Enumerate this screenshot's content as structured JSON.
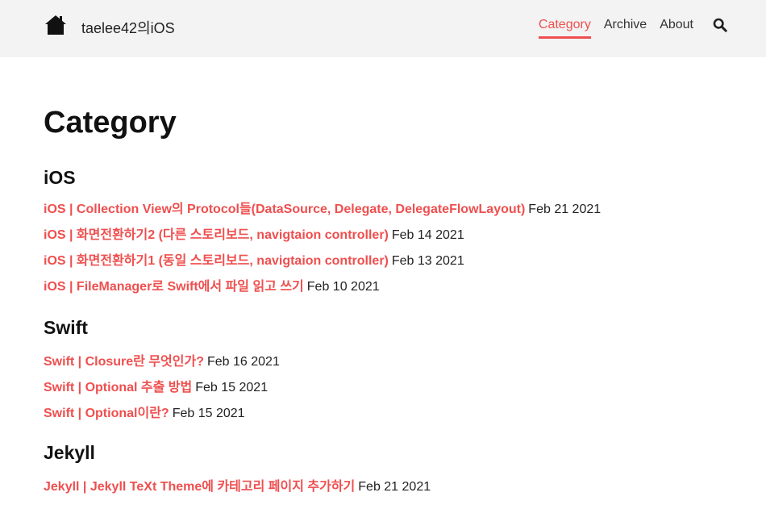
{
  "header": {
    "site_title": "taelee42의iOS",
    "nav": [
      {
        "label": "Category",
        "active": true
      },
      {
        "label": "Archive",
        "active": false
      },
      {
        "label": "About",
        "active": false
      }
    ]
  },
  "main": {
    "page_title": "Category",
    "sections": [
      {
        "heading": "iOS",
        "posts": [
          {
            "title": "iOS | Collection View의 Protocol들(DataSource, Delegate, DelegateFlowLayout)",
            "date": "Feb 21 2021"
          },
          {
            "title": "iOS | 화면전환하기2 (다른 스토리보드, navigtaion controller)",
            "date": "Feb 14 2021"
          },
          {
            "title": "iOS | 화면전환하기1 (동일 스토리보드, navigtaion controller)",
            "date": "Feb 13 2021"
          },
          {
            "title": "iOS | FileManager로 Swift에서 파일 읽고 쓰기",
            "date": "Feb 10 2021"
          }
        ]
      },
      {
        "heading": "Swift",
        "posts": [
          {
            "title": "Swift | Closure란 무엇인가?",
            "date": "Feb 16 2021"
          },
          {
            "title": "Swift | Optional 추출 방법",
            "date": "Feb 15 2021"
          },
          {
            "title": "Swift | Optional이란?",
            "date": "Feb 15 2021"
          }
        ]
      },
      {
        "heading": "Jekyll",
        "posts": [
          {
            "title": "Jekyll | Jekyll TeXt Theme에 카테고리 페이지 추가하기",
            "date": "Feb 21 2021"
          }
        ]
      }
    ]
  },
  "colors": {
    "accent": "#ef4f4f",
    "header_bg": "#f3f3f3",
    "text": "#111111"
  },
  "icons": {
    "home": "home-icon",
    "search": "search-icon"
  }
}
